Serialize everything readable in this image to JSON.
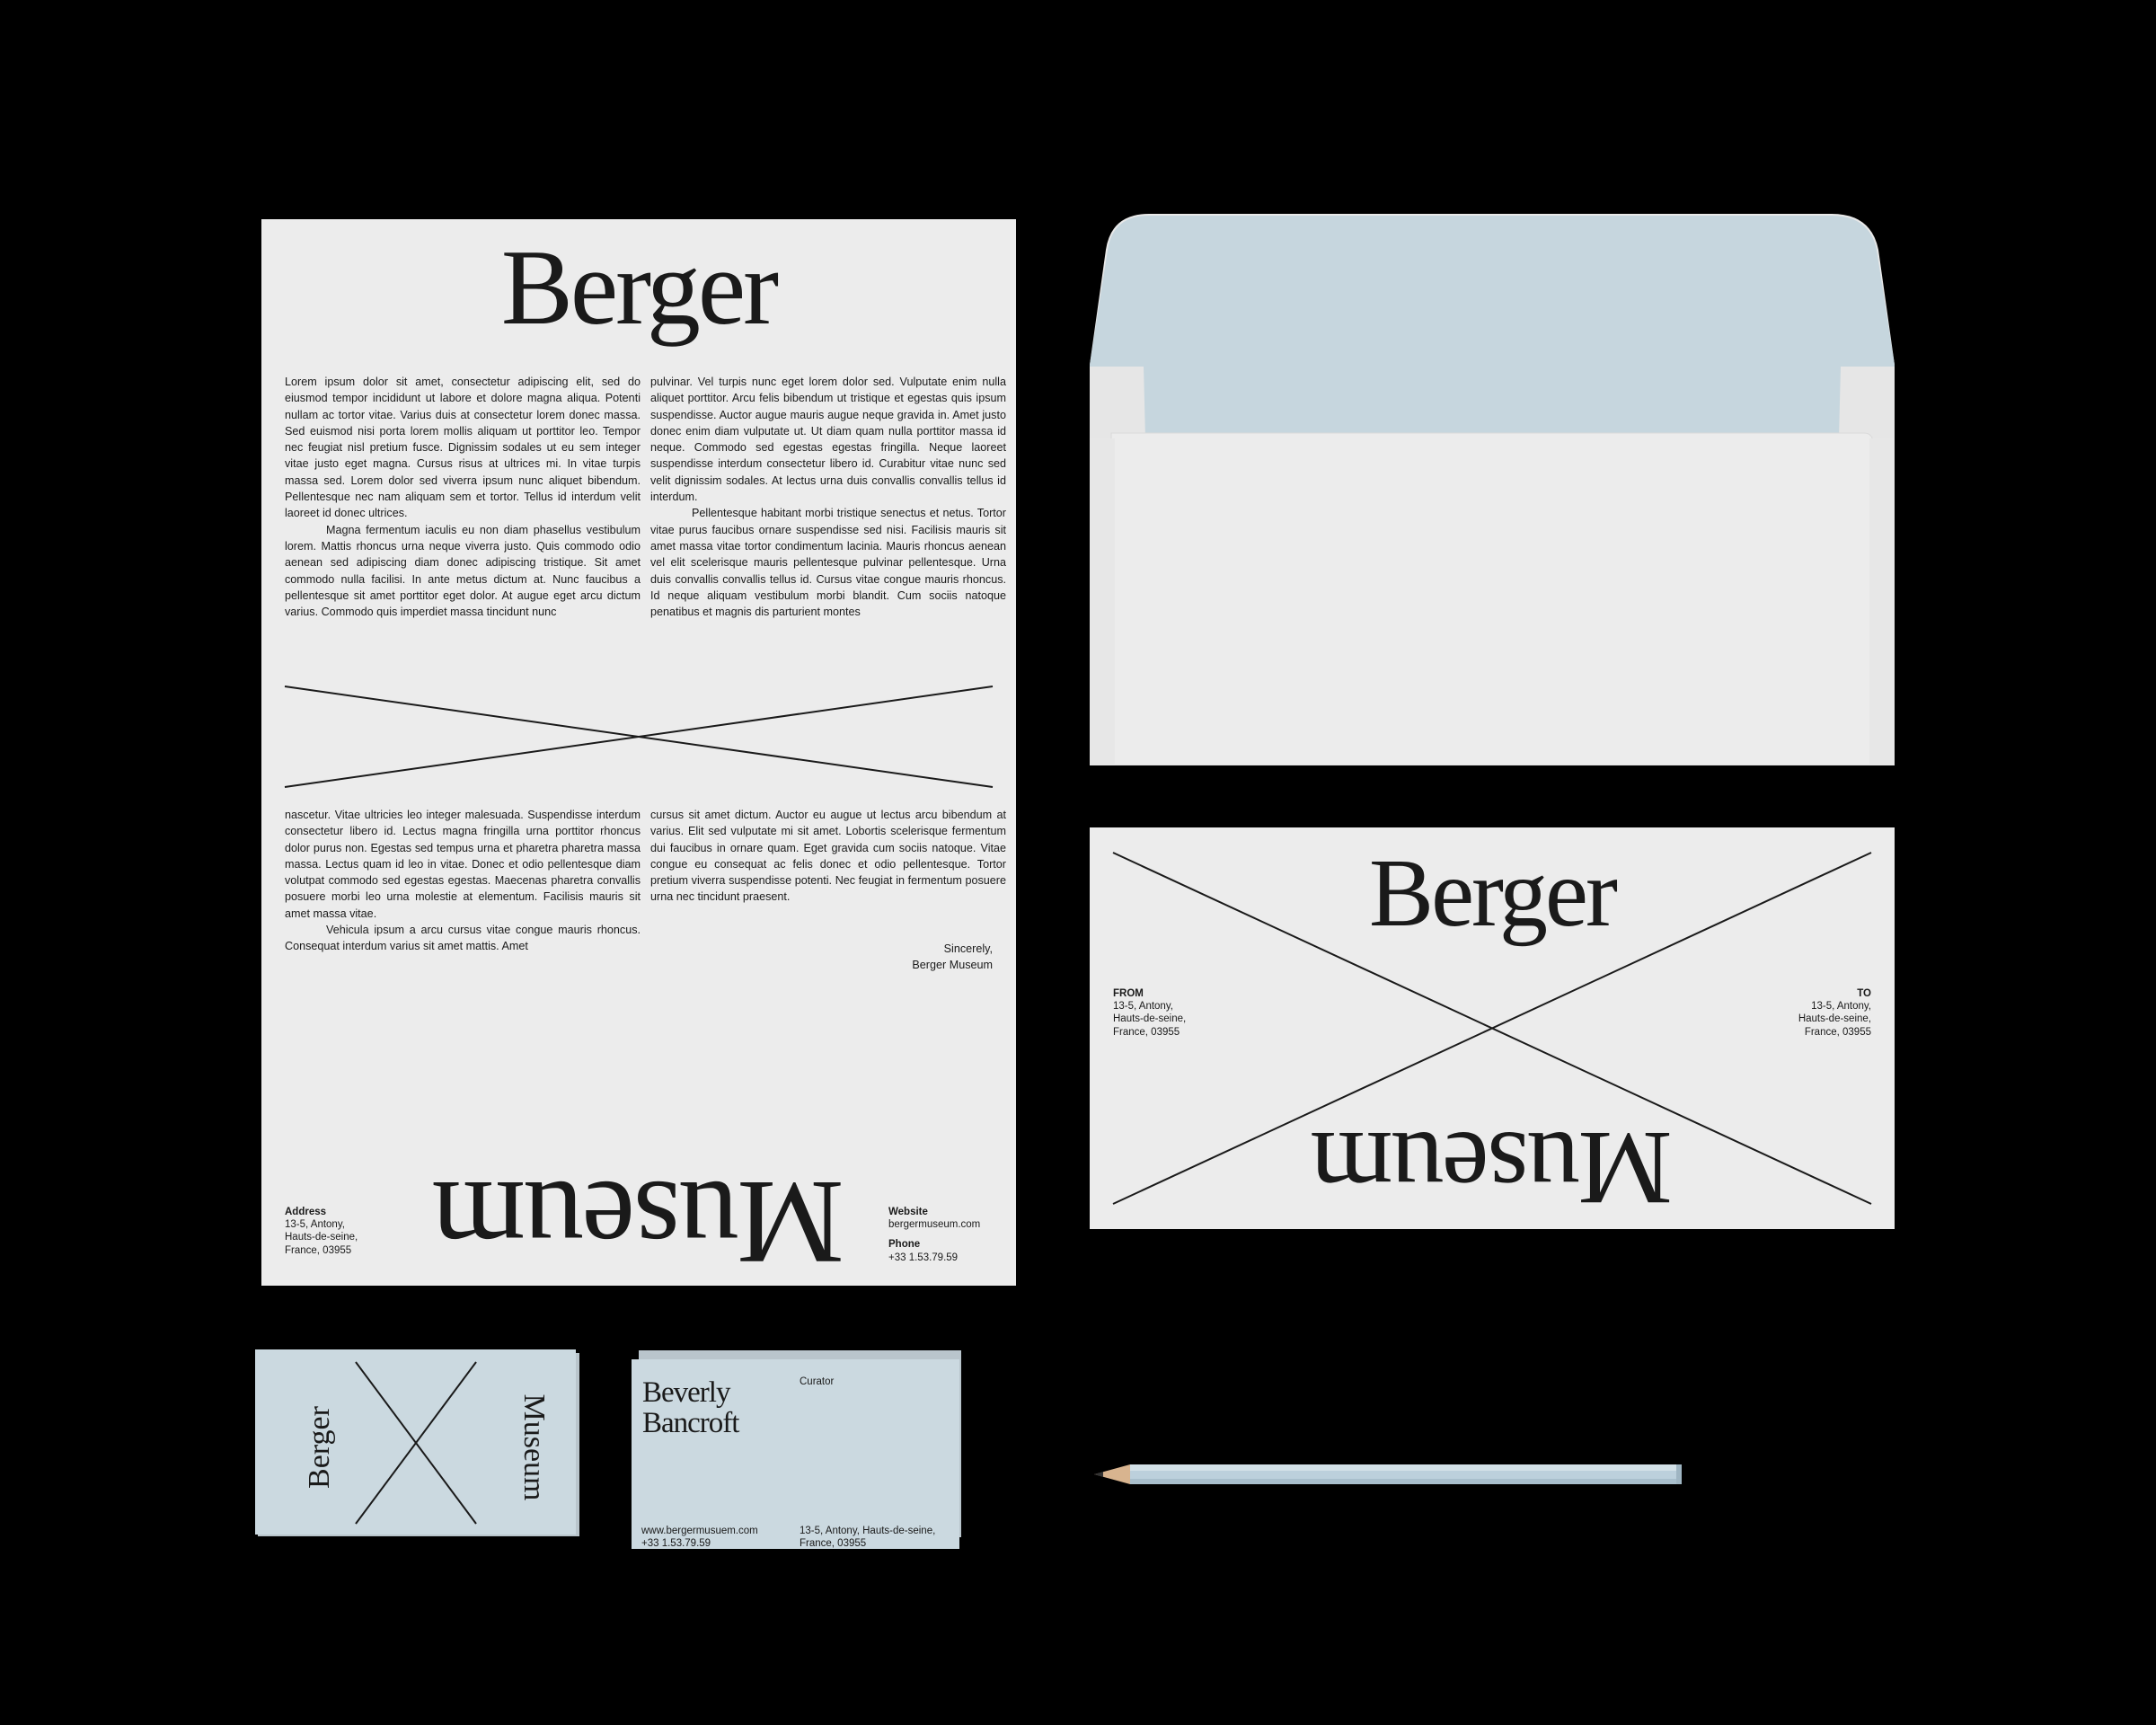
{
  "letterhead": {
    "title": "Berger",
    "paragraphs_top_left": [
      "Lorem ipsum dolor sit amet, consectetur adipiscing elit, sed do eiusmod tempor incididunt ut labore et dolore magna aliqua. Potenti nullam ac tortor vitae. Varius duis at consectetur lorem donec massa. Sed euismod nisi porta lorem mollis aliquam ut porttitor leo. Tempor nec feugiat nisl pretium fusce. Dignissim sodales ut eu sem integer vitae justo eget magna. Cursus risus at ultrices mi. In vitae turpis massa sed. Lorem dolor sed viverra ipsum nunc aliquet bibendum. Pellentesque nec nam aliquam sem et tortor. Tellus id interdum velit laoreet id donec ultrices.",
      "Magna fermentum iaculis eu non diam phasellus vestibulum lorem. Mattis rhoncus urna neque viverra justo. Quis commodo odio aenean sed adipiscing diam donec adipiscing tristique. Sit amet commodo nulla facilisi. In ante metus dictum at. Nunc faucibus a pellentesque sit amet porttitor eget dolor. At augue eget arcu dictum varius. Commodo quis imperdiet massa tincidunt nunc"
    ],
    "paragraphs_top_right": [
      "pulvinar. Vel turpis nunc eget lorem dolor sed. Vulputate enim nulla aliquet porttitor. Arcu felis bibendum ut tristique et egestas quis ipsum suspendisse. Auctor augue mauris augue neque gravida in. Amet justo donec enim diam vulputate ut. Ut diam quam nulla porttitor massa id neque. Commodo sed egestas egestas fringilla. Neque laoreet suspendisse interdum consectetur libero id. Curabitur vitae nunc sed velit dignissim sodales. At lectus urna duis convallis convallis tellus id interdum.",
      "Pellentesque habitant morbi tristique senectus et netus. Tortor vitae purus faucibus ornare suspendisse sed nisi. Facilisis mauris sit amet massa vitae tortor condimentum lacinia. Mauris rhoncus aenean vel elit scelerisque mauris pellentesque pulvinar pellentesque. Urna duis convallis convallis tellus id. Cursus vitae congue mauris rhoncus. Id neque aliquam vestibulum morbi blandit. Cum sociis natoque penatibus et magnis dis parturient montes"
    ],
    "paragraphs_bottom_left": [
      "nascetur. Vitae ultricies leo integer malesuada. Suspendisse interdum consectetur libero id. Lectus magna fringilla urna porttitor rhoncus dolor purus non. Egestas sed tempus urna et pharetra pharetra massa massa. Lectus quam id leo in vitae. Donec et odio pellentesque diam volutpat commodo sed egestas egestas. Maecenas pharetra convallis posuere morbi leo urna molestie at elementum. Facilisis mauris sit amet massa vitae.",
      "Vehicula ipsum a arcu cursus vitae congue mauris rhoncus. Consequat interdum varius sit amet mattis. Amet"
    ],
    "paragraphs_bottom_right": [
      "cursus sit amet dictum. Auctor eu augue ut lectus arcu bibendum at varius. Elit sed vulputate mi sit amet. Lobortis scelerisque fermentum dui faucibus in ornare quam. Eget gravida cum sociis natoque. Vitae congue eu consequat ac felis donec et odio pellentesque. Tortor pretium viverra suspendisse potenti. Nec feugiat in fermentum posuere urna nec tincidunt praesent."
    ],
    "signoff_line1": "Sincerely,",
    "signoff_line2": "Berger Museum",
    "footer_word": "Museum",
    "address_label": "Address",
    "address_line1": "13-5, Antony,",
    "address_line2": "Hauts-de-seine,",
    "address_line3": "France, 03955",
    "website_label": "Website",
    "website_value": "bergermuseum.com",
    "phone_label": "Phone",
    "phone_value": "+33 1.53.79.59"
  },
  "envelope_front": {
    "title": "Berger",
    "footer_word": "Museum",
    "from_label": "FROM",
    "from_line1": "13-5, Antony,",
    "from_line2": "Hauts-de-seine,",
    "from_line3": "France, 03955",
    "to_label": "TO",
    "to_line1": "13-5, Antony,",
    "to_line2": "Hauts-de-seine,",
    "to_line3": "France, 03955"
  },
  "card_back": {
    "left_word": "Berger",
    "right_word": "Museum"
  },
  "card_front": {
    "name_line1": "Beverly",
    "name_line2": "Bancroft",
    "role": "Curator",
    "website": "www.bergermusuem.com",
    "phone": "+33 1.53.79.59",
    "address_line1": "13-5, Antony, Hauts-de-seine,",
    "address_line2": "France, 03955"
  },
  "colors": {
    "background": "#000000",
    "paper": "#ececec",
    "envelope_liner": "#c6d6de",
    "card": "#cbd9e0",
    "ink": "#1a1a1a"
  }
}
